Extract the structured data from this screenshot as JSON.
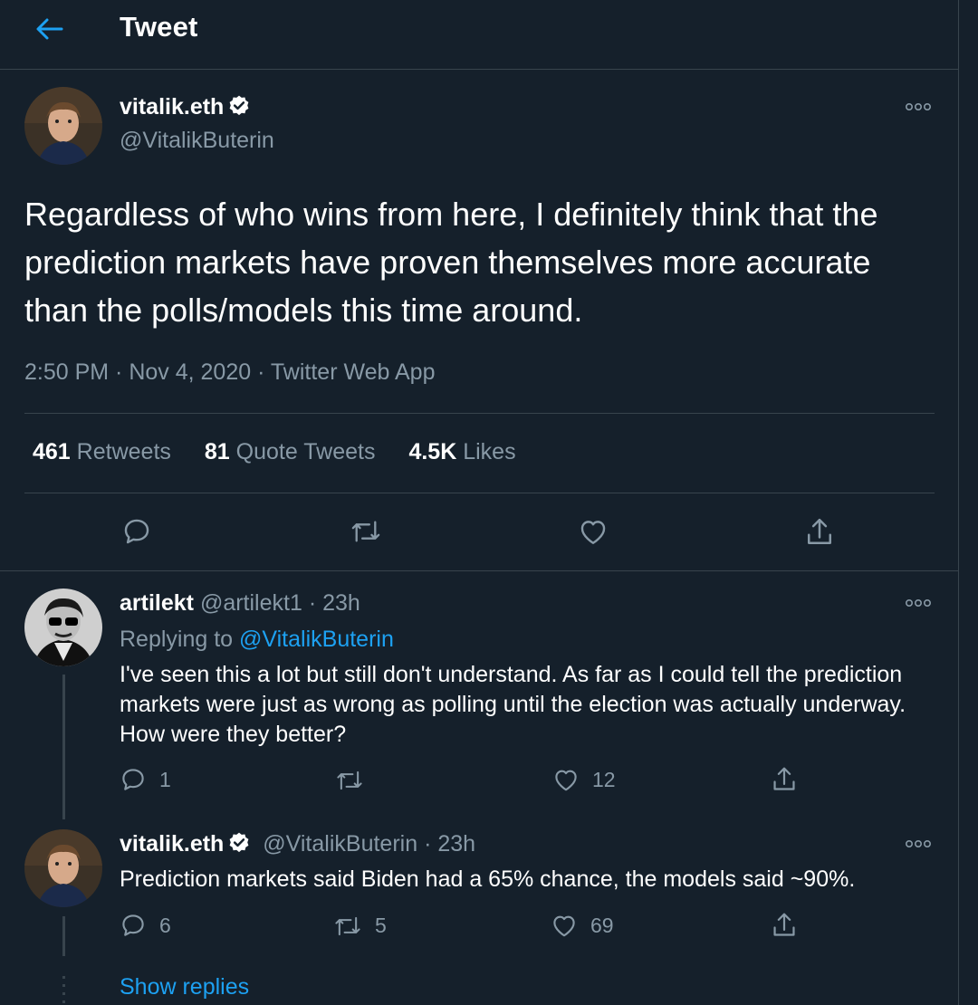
{
  "header": {
    "title": "Tweet"
  },
  "main_tweet": {
    "display_name": "vitalik.eth",
    "handle": "@VitalikButerin",
    "text": "Regardless of who wins from here, I definitely think that the prediction markets have proven themselves more accurate than the polls/models this time around.",
    "meta": "2:50 PM · Nov 4, 2020 · Twitter Web App",
    "stats": {
      "retweets_count": "461",
      "retweets_label": "Retweets",
      "quotes_count": "81",
      "quotes_label": "Quote Tweets",
      "likes_count": "4.5K",
      "likes_label": "Likes"
    }
  },
  "replies": [
    {
      "display_name": "artilekt",
      "handle": "@artilekt1",
      "time": "· 23h",
      "replying_prefix": "Replying to",
      "replying_to": "@VitalikButerin",
      "text": "I've seen this a lot but still don't understand. As far as I could tell the prediction markets were just as wrong as polling until the election was actually underway. How were they better?",
      "reply_count": "1",
      "retweet_count": "",
      "like_count": "12"
    },
    {
      "display_name": "vitalik.eth",
      "handle": "@VitalikButerin",
      "time": "· 23h",
      "text": "Prediction markets said Biden had a 65% chance, the models said ~90%.",
      "reply_count": "6",
      "retweet_count": "5",
      "like_count": "69"
    }
  ],
  "show_replies": "Show replies",
  "colors": {
    "background": "#15202b",
    "border": "#38444d",
    "muted_text": "#8899a6",
    "accent": "#1da1f2"
  },
  "icons": [
    "back-arrow-icon",
    "verified-badge-icon",
    "more-icon",
    "reply-icon",
    "retweet-icon",
    "like-icon",
    "share-icon"
  ]
}
